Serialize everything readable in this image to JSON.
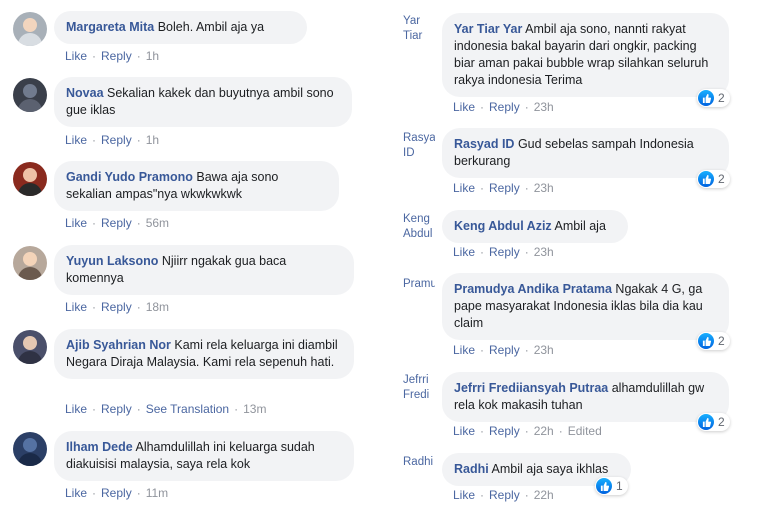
{
  "left_comments": [
    {
      "author": "Margareta Mita",
      "text": "Boleh. Ambil aja ya",
      "like": "Like",
      "reply": "Reply",
      "time": "1h",
      "avatar_color": "#a8b0b8"
    },
    {
      "author": "Novaa",
      "text": "Sekalian kakek dan buyutnya ambil sono gue iklas",
      "like": "Like",
      "reply": "Reply",
      "time": "1h",
      "avatar_color": "#3a3f4a"
    },
    {
      "author": "Gandi Yudo Pramono",
      "text": "Bawa aja sono sekalian ampas\"nya wkwkwkwk",
      "like": "Like",
      "reply": "Reply",
      "time": "56m",
      "avatar_color": "#8a2a1e"
    },
    {
      "author": "Yuyun Laksono",
      "text": "Njiirr ngakak gua baca komennya",
      "like": "Like",
      "reply": "Reply",
      "time": "18m",
      "avatar_color": "#6b5a4e"
    },
    {
      "author": "Ajib Syahrian Nor",
      "text": "Kami rela keluarga ini diambil Negara Diraja Malaysia. Kami rela sepenuh hati.",
      "like": "Like",
      "reply": "Reply",
      "translation": "See Translation",
      "time": "13m",
      "avatar_color": "#4a4f6a"
    },
    {
      "author": "Ilham Dede",
      "text": "Alhamdulillah ini keluarga sudah diakuisisi malaysia, saya rela kok",
      "like": "Like",
      "reply": "Reply",
      "time": "11m",
      "avatar_color": "#2b3f66"
    }
  ],
  "right_comments": [
    {
      "cut_name": "Yar Tiar",
      "author": "Yar Tiar Yar",
      "text": "Ambil aja sono, nannti rakyat indonesia bakal bayarin dari ongkir, packing biar aman pakai bubble wrap silahkan seluruh rakya indonesia Terima",
      "like": "Like",
      "reply": "Reply",
      "time": "23h",
      "reactions": "2"
    },
    {
      "cut_name": "Rasyad ID",
      "author": "Rasyad ID",
      "text": "Gud sebelas sampah Indonesia berkurang",
      "like": "Like",
      "reply": "Reply",
      "time": "23h",
      "reactions": "2"
    },
    {
      "cut_name": "Keng Abdul",
      "author": "Keng Abdul Aziz",
      "text": "Ambil aja",
      "like": "Like",
      "reply": "Reply",
      "time": "23h"
    },
    {
      "cut_name": "Pramudya",
      "author": "Pramudya Andika Pratama",
      "text": "Ngakak 4 G, ga pape masyarakat Indonesia iklas bila dia kau claim",
      "like": "Like",
      "reply": "Reply",
      "time": "23h",
      "reactions": "2"
    },
    {
      "cut_name": "Jefrri Fredi",
      "author": "Jefrri Frediiansyah Putraa",
      "text": "alhamdulillah gw rela kok makasih tuhan",
      "like": "Like",
      "reply": "Reply",
      "time": "22h",
      "edited": "Edited",
      "reactions": "2"
    },
    {
      "cut_name": "Radhi",
      "author": "Radhi",
      "text": "Ambil aja saya ikhlas",
      "like": "Like",
      "reply": "Reply",
      "time": "22h",
      "reactions": "1"
    }
  ],
  "colors": {
    "author": "#385898",
    "bubble": "#f2f3f5",
    "link": "#4b67a1",
    "meta": "#90949c",
    "like_blue": "#1877f2"
  },
  "icons": {
    "reaction": "thumbs-up-icon"
  }
}
